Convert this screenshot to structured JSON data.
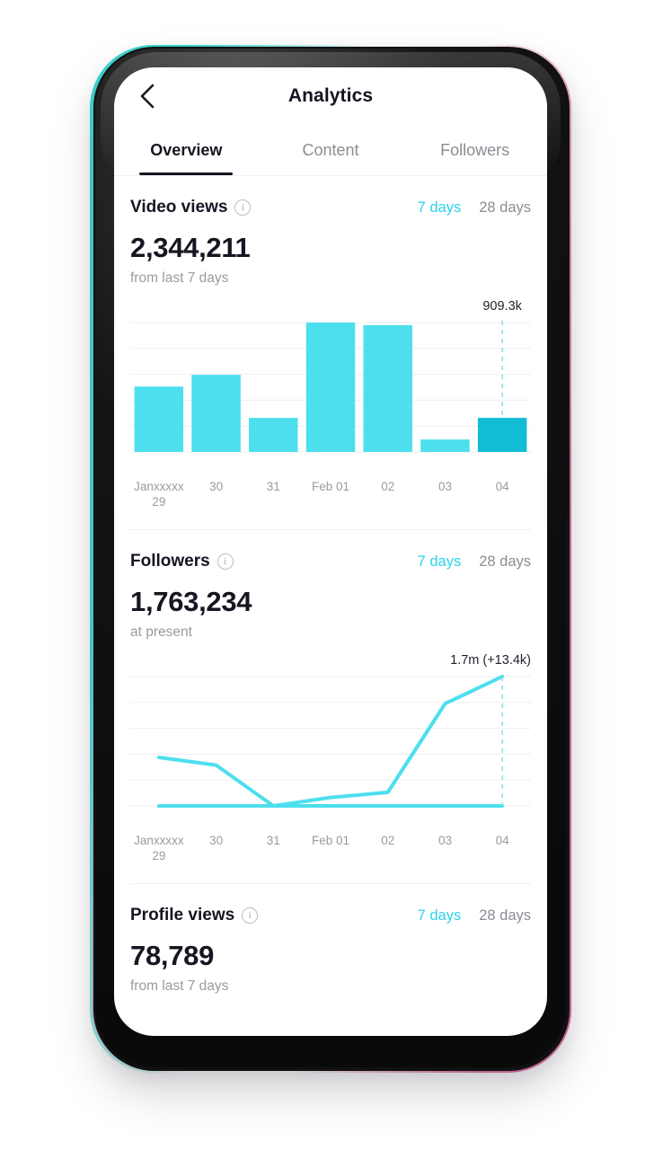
{
  "header": {
    "title": "Analytics",
    "back_icon": "chevron-left-icon"
  },
  "tabs": [
    {
      "label": "Overview",
      "active": true
    },
    {
      "label": "Content",
      "active": false
    },
    {
      "label": "Followers",
      "active": false
    }
  ],
  "range_options": {
    "short": "7 days",
    "long": "28 days",
    "active": "7 days"
  },
  "sections": [
    {
      "title": "Video views",
      "info_icon": "info-icon",
      "value": "2,344,211",
      "subtitle": "from last 7 days"
    },
    {
      "title": "Followers",
      "info_icon": "info-icon",
      "value": "1,763,234",
      "subtitle": "at present"
    },
    {
      "title": "Profile views",
      "info_icon": "info-icon",
      "value": "78,789",
      "subtitle": "from last 7 days"
    }
  ],
  "colors": {
    "accent_cyan": "#4ddfee",
    "accent_cyan_dark": "#12bcd4",
    "brand_cyan": "#2ad3e8",
    "text_dark": "#161622",
    "text_muted": "#9a9aa2",
    "gridline": "#f1f1f3",
    "frame_edge_cyan": "#37d9d4",
    "frame_edge_pink": "#e35a9b"
  },
  "chart_data": [
    {
      "type": "bar",
      "title": "Video views",
      "xlabel": "",
      "ylabel": "",
      "categories": [
        "Janxxxxx 29",
        "30",
        "31",
        "Feb 01",
        "02",
        "03",
        "04"
      ],
      "category_lines": [
        [
          "Janxxxxx",
          "29"
        ],
        [
          "30",
          ""
        ],
        [
          "31",
          ""
        ],
        [
          "Feb 01",
          ""
        ],
        [
          "02",
          ""
        ],
        [
          "03",
          ""
        ],
        [
          "04",
          ""
        ]
      ],
      "values": [
        500000,
        590000,
        260000,
        990000,
        970000,
        95000,
        260000
      ],
      "values_normalized": [
        0.505,
        0.596,
        0.263,
        1.0,
        0.98,
        0.096,
        0.263
      ],
      "annotation": {
        "text": "909.3k",
        "category": "04",
        "dashed_guide": true
      },
      "highlight_index": 6,
      "grid": true,
      "gridlines": 5,
      "ylim": [
        0,
        990000
      ],
      "legend": "none"
    },
    {
      "type": "line",
      "title": "Followers",
      "xlabel": "",
      "ylabel": "",
      "categories": [
        "Janxxxxx 29",
        "30",
        "31",
        "Feb 01",
        "02",
        "03",
        "04"
      ],
      "category_lines": [
        [
          "Janxxxxx",
          "29"
        ],
        [
          "30",
          ""
        ],
        [
          "31",
          ""
        ],
        [
          "Feb 01",
          ""
        ],
        [
          "02",
          ""
        ],
        [
          "03",
          ""
        ],
        [
          "04",
          ""
        ]
      ],
      "series": [
        {
          "name": "Followers",
          "values_normalized": [
            0.375,
            0.315,
            0.0,
            0.065,
            0.105,
            0.79,
            1.0
          ]
        },
        {
          "name": "Baseline",
          "values_normalized": [
            0,
            0,
            0,
            0,
            0,
            0,
            0
          ]
        }
      ],
      "annotation": {
        "text": "1.7m (+13.4k)",
        "category": "04",
        "dashed_guide": true
      },
      "grid": true,
      "gridlines": 5,
      "legend": "none"
    }
  ]
}
